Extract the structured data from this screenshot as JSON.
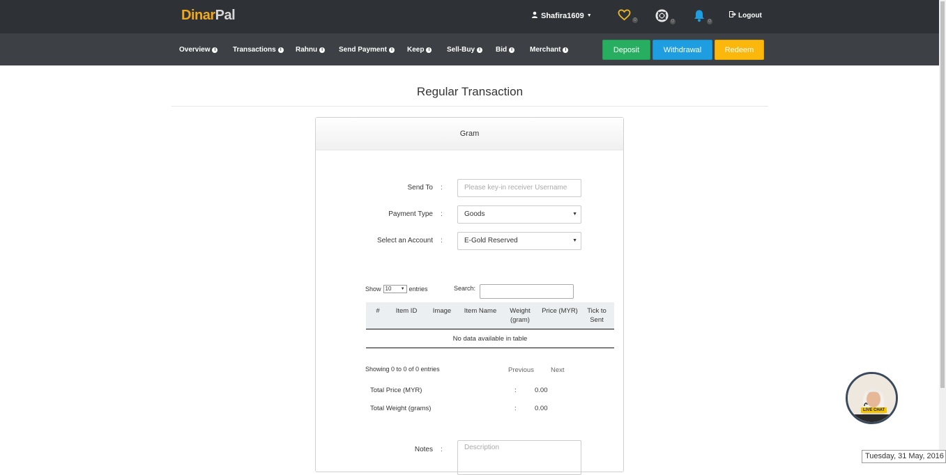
{
  "brand": {
    "part1": "Dinar",
    "part2": "Pal"
  },
  "header": {
    "username": "Shafira1609",
    "favorites_count": "0",
    "support_count": "0",
    "notifications_count": "0",
    "logout_label": "Logout"
  },
  "nav": {
    "items": [
      {
        "label": "Overview"
      },
      {
        "label": "Transactions"
      },
      {
        "label": "Rahnu"
      },
      {
        "label": "Send Payment"
      },
      {
        "label": "Keep"
      },
      {
        "label": "Sell-Buy"
      },
      {
        "label": "Bid"
      },
      {
        "label": "Merchant"
      }
    ],
    "deposit_label": "Deposit",
    "withdrawal_label": "Withdrawal",
    "redeem_label": "Redeem"
  },
  "page": {
    "title": "Regular Transaction"
  },
  "panel": {
    "heading": "Gram"
  },
  "form": {
    "send_to_label": "Send To",
    "send_to_placeholder": "Please key-in receiver Username",
    "payment_type_label": "Payment Type",
    "payment_type_value": "Goods",
    "account_label": "Select an Account",
    "account_value": "E-Gold Reserved",
    "colon": ":"
  },
  "table": {
    "show_label": "Show",
    "entries_value": "10",
    "entries_label": "entries",
    "search_label": "Search:",
    "columns": [
      "#",
      "Item ID",
      "Image",
      "Item Name",
      "Weight (gram)",
      "Price (MYR)",
      "Tick to Sent"
    ],
    "empty_message": "No data available in table",
    "info": "Showing 0 to 0 of 0 entries",
    "previous_label": "Previous",
    "next_label": "Next"
  },
  "summary": {
    "total_price_label": "Total Price (MYR)",
    "total_price_value": "0.00",
    "total_weight_label": "Total Weight (grams)",
    "total_weight_value": "0.00"
  },
  "notes": {
    "label": "Notes",
    "placeholder": "Description"
  },
  "live_chat": {
    "label": "LIVE CHAT"
  },
  "date_display": "Tuesday, 31 May, 2016",
  "colors": {
    "topbar": "#2e3237",
    "navbar": "#3d4145",
    "brand_accent": "#f0a81e",
    "deposit": "#27ae60",
    "withdrawal": "#1e9ee0",
    "redeem": "#fbb70b",
    "favorites_icon": "#e8b52a",
    "notifications_icon": "#1e9ee0"
  },
  "icons": [
    "user-icon",
    "heart-icon",
    "lifebuoy-icon",
    "bell-icon",
    "logout-icon",
    "info-icon",
    "caret-down-icon"
  ]
}
